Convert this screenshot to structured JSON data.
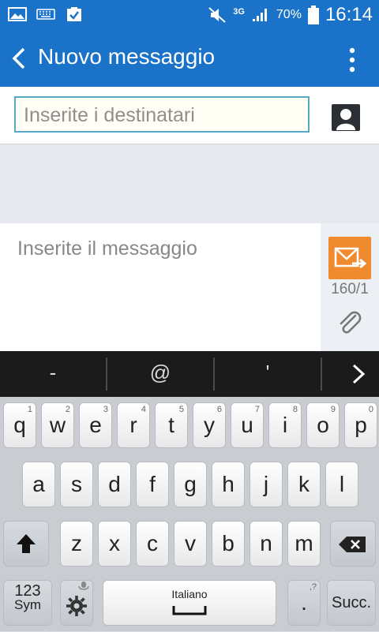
{
  "status_bar": {
    "network_type": "3G",
    "battery_percent": "70%",
    "time": "16:14"
  },
  "app_bar": {
    "title": "Nuovo messaggio"
  },
  "recipients": {
    "placeholder": "Inserite i destinatari"
  },
  "message": {
    "placeholder": "Inserite il messaggio",
    "char_counter": "160/1"
  },
  "suggestions": [
    "-",
    "@",
    "'"
  ],
  "keyboard": {
    "row1": [
      {
        "key": "q",
        "hint": "1"
      },
      {
        "key": "w",
        "hint": "2"
      },
      {
        "key": "e",
        "hint": "3"
      },
      {
        "key": "r",
        "hint": "4"
      },
      {
        "key": "t",
        "hint": "5"
      },
      {
        "key": "y",
        "hint": "6"
      },
      {
        "key": "u",
        "hint": "7"
      },
      {
        "key": "i",
        "hint": "8"
      },
      {
        "key": "o",
        "hint": "9"
      },
      {
        "key": "p",
        "hint": "0"
      }
    ],
    "row2": [
      "a",
      "s",
      "d",
      "f",
      "g",
      "h",
      "j",
      "k",
      "l"
    ],
    "row3": [
      "z",
      "x",
      "c",
      "v",
      "b",
      "n",
      "m"
    ],
    "symbols_label": "123",
    "symbols_sub": "Sym",
    "space_label": "Italiano",
    "period_label": ".",
    "period_hint": ",?",
    "next_label": "Succ."
  },
  "colors": {
    "primary": "#1a73c8",
    "send_button": "#f08a2e",
    "input_border": "#57a8c6"
  }
}
